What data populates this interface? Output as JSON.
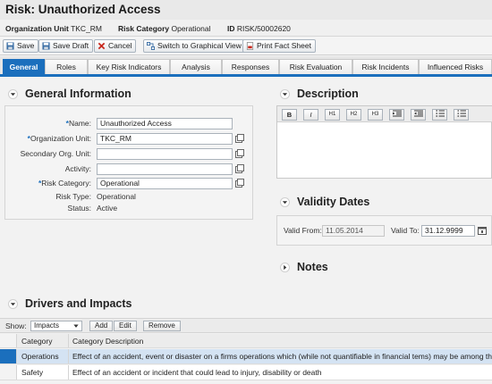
{
  "page": {
    "title": "Risk: Unauthorized Access"
  },
  "meta": {
    "org_unit_label": "Organization Unit",
    "org_unit_value": "TKC_RM",
    "category_label": "Risk Category",
    "category_value": "Operational",
    "id_label": "ID",
    "id_value": "RISK/50002620"
  },
  "toolbar": {
    "save": "Save",
    "save_draft": "Save Draft",
    "cancel": "Cancel",
    "graphical": "Switch to Graphical View",
    "print": "Print Fact Sheet"
  },
  "tabs": [
    "General",
    "Roles",
    "Key Risk Indicators",
    "Analysis",
    "Responses",
    "Risk Evaluation",
    "Risk Incidents",
    "Influenced Risks"
  ],
  "general": {
    "title": "General Information",
    "fields": {
      "name_label": "Name:",
      "name_value": "Unauthorized Access",
      "org_label": "Organization Unit:",
      "org_value": "TKC_RM",
      "sec_org_label": "Secondary Org. Unit:",
      "sec_org_value": "",
      "activity_label": "Activity:",
      "activity_value": "",
      "category_label": "Risk Category:",
      "category_value": "Operational",
      "type_label": "Risk Type:",
      "type_value": "Operational",
      "status_label": "Status:",
      "status_value": "Active"
    }
  },
  "description": {
    "title": "Description",
    "rt_buttons": [
      "B",
      "I",
      "H1",
      "H2",
      "H3"
    ]
  },
  "validity": {
    "title": "Validity Dates",
    "from_label": "Valid From:",
    "from_value": "11.05.2014",
    "to_label": "Valid To:",
    "to_value": "31.12.9999"
  },
  "notes": {
    "title": "Notes"
  },
  "drivers": {
    "title": "Drivers and Impacts",
    "show_label": "Show:",
    "show_value": "Impacts",
    "add": "Add",
    "edit": "Edit",
    "remove": "Remove",
    "columns": [
      "Category",
      "Category Description"
    ],
    "rows": [
      {
        "category": "Operations",
        "description": "Effect of an accident, event or disaster on a firms operations which (while not quantifiable in financial tems) may be among th most sev"
      },
      {
        "category": "Safety",
        "description": "Effect of an accident or incident that could lead to injury, disability or death"
      }
    ]
  },
  "colors": {
    "accent": "#1b6fbd",
    "selected_row": "#d4e3f3"
  }
}
